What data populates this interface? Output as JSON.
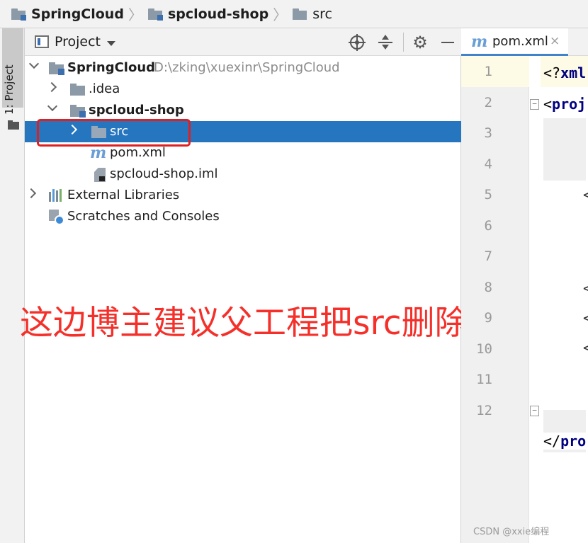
{
  "breadcrumb": {
    "items": [
      "SpringCloud",
      "spcloud-shop",
      "src"
    ]
  },
  "tool_strip": {
    "project_tab_label": "1: Project"
  },
  "project_panel": {
    "title": "Project",
    "tree": {
      "root_label": "SpringCloud",
      "root_path": "D:\\zking\\xuexinr\\SpringCloud",
      "idea_label": ".idea",
      "module_label": "spcloud-shop",
      "src_label": "src",
      "pom_label": "pom.xml",
      "iml_label": "spcloud-shop.iml",
      "external_libraries_label": "External Libraries",
      "scratches_label": "Scratches and Consoles"
    }
  },
  "annotation": {
    "text": "这边博主建议父工程把src删除",
    "color": "#f5302a"
  },
  "editor": {
    "tab_label": "pom.xml",
    "tab_close": "×",
    "line_numbers": [
      "1",
      "2",
      "3",
      "4",
      "5",
      "6",
      "7",
      "8",
      "9",
      "10",
      "11",
      "12"
    ],
    "code": {
      "line1_prefix": "<?",
      "line1_tag": "xml",
      "line2_prefix": "<",
      "line2_tag": "proj",
      "line12_prefix": "</",
      "line12_tag": "pro"
    }
  },
  "watermark": "CSDN @xxie编程",
  "colors": {
    "selection": "#2675bf",
    "highlight_box": "#e02020",
    "xml_tag": "#000080"
  }
}
